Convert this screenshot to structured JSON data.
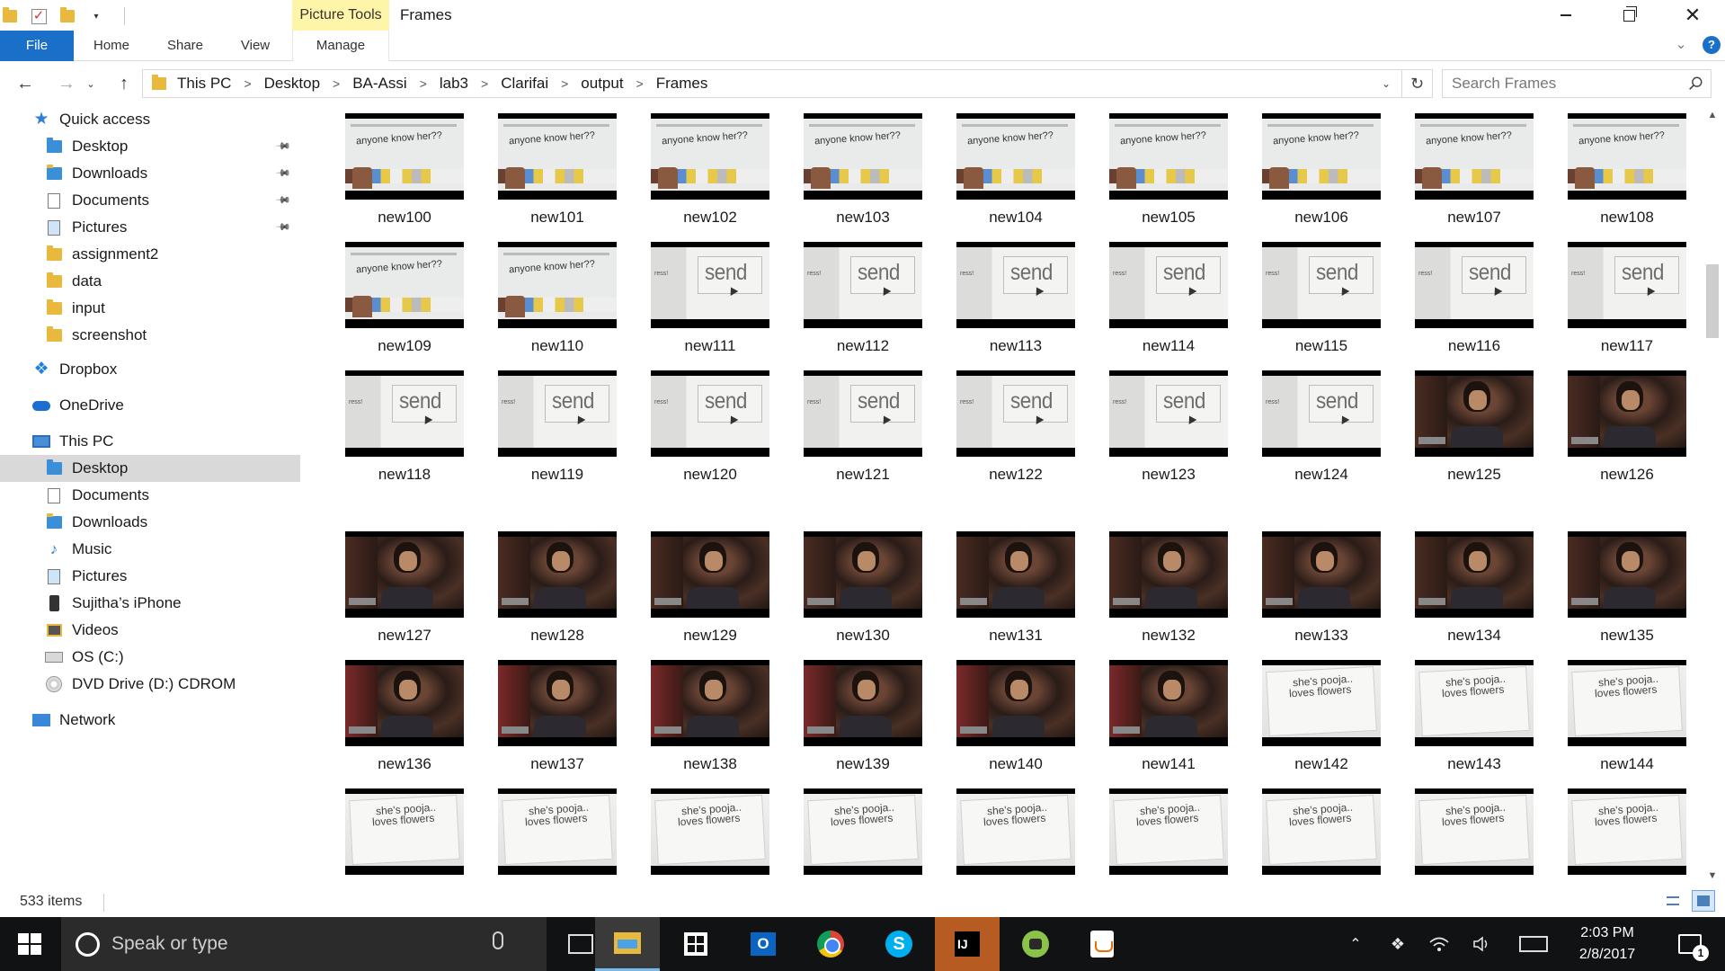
{
  "window": {
    "title": "Frames",
    "context_tab_header": "Picture Tools",
    "minimize_label": "–",
    "close_label": "✕"
  },
  "ribbon": {
    "tabs": [
      "File",
      "Home",
      "Share",
      "View",
      "Manage"
    ],
    "help_label": "?"
  },
  "address": {
    "breadcrumb": [
      "This PC",
      "Desktop",
      "BA-Assi",
      "lab3",
      "Clarifai",
      "output",
      "Frames"
    ],
    "separator": ">",
    "search_placeholder": "Search Frames"
  },
  "nav_pane": {
    "items": [
      {
        "label": "Quick access",
        "icon": "star-icon",
        "level": 0,
        "selected": false,
        "pinned": false
      },
      {
        "label": "Desktop",
        "icon": "folder-blue-icon",
        "level": 1,
        "selected": false,
        "pinned": true
      },
      {
        "label": "Downloads",
        "icon": "downloads-folder-icon",
        "level": 1,
        "selected": false,
        "pinned": true
      },
      {
        "label": "Documents",
        "icon": "documents-folder-icon",
        "level": 1,
        "selected": false,
        "pinned": true
      },
      {
        "label": "Pictures",
        "icon": "pictures-folder-icon",
        "level": 1,
        "selected": false,
        "pinned": true
      },
      {
        "label": "assignment2",
        "icon": "folder-icon",
        "level": 1,
        "selected": false,
        "pinned": false
      },
      {
        "label": "data",
        "icon": "folder-icon",
        "level": 1,
        "selected": false,
        "pinned": false
      },
      {
        "label": "input",
        "icon": "folder-icon",
        "level": 1,
        "selected": false,
        "pinned": false
      },
      {
        "label": "screenshot",
        "icon": "folder-icon",
        "level": 1,
        "selected": false,
        "pinned": false
      },
      {
        "label": "Dropbox",
        "icon": "dropbox-icon",
        "level": 0,
        "selected": false,
        "pinned": false
      },
      {
        "label": "OneDrive",
        "icon": "onedrive-icon",
        "level": 0,
        "selected": false,
        "pinned": false
      },
      {
        "label": "This PC",
        "icon": "computer-icon",
        "level": 0,
        "selected": false,
        "pinned": false
      },
      {
        "label": "Desktop",
        "icon": "folder-blue-icon",
        "level": 1,
        "selected": true,
        "pinned": false
      },
      {
        "label": "Documents",
        "icon": "documents-folder-icon",
        "level": 1,
        "selected": false,
        "pinned": false
      },
      {
        "label": "Downloads",
        "icon": "downloads-folder-icon",
        "level": 1,
        "selected": false,
        "pinned": false
      },
      {
        "label": "Music",
        "icon": "music-folder-icon",
        "level": 1,
        "selected": false,
        "pinned": false
      },
      {
        "label": "Pictures",
        "icon": "pictures-folder-icon",
        "level": 1,
        "selected": false,
        "pinned": false
      },
      {
        "label": "Sujitha’s iPhone",
        "icon": "phone-icon",
        "level": 1,
        "selected": false,
        "pinned": false
      },
      {
        "label": "Videos",
        "icon": "videos-folder-icon",
        "level": 1,
        "selected": false,
        "pinned": false
      },
      {
        "label": "OS (C:)",
        "icon": "drive-icon",
        "level": 1,
        "selected": false,
        "pinned": false
      },
      {
        "label": "DVD Drive (D:) CDROM",
        "icon": "dvd-icon",
        "level": 1,
        "selected": false,
        "pinned": false
      },
      {
        "label": "Network",
        "icon": "network-icon",
        "level": 0,
        "selected": false,
        "pinned": false
      }
    ]
  },
  "files": [
    {
      "name": "new100",
      "scene": "anyone"
    },
    {
      "name": "new101",
      "scene": "anyone"
    },
    {
      "name": "new102",
      "scene": "anyone"
    },
    {
      "name": "new103",
      "scene": "anyone"
    },
    {
      "name": "new104",
      "scene": "anyone"
    },
    {
      "name": "new105",
      "scene": "anyone"
    },
    {
      "name": "new106",
      "scene": "anyone"
    },
    {
      "name": "new107",
      "scene": "anyone"
    },
    {
      "name": "new108",
      "scene": "anyone"
    },
    {
      "name": "new109",
      "scene": "anyone"
    },
    {
      "name": "new110",
      "scene": "anyone"
    },
    {
      "name": "new111",
      "scene": "send"
    },
    {
      "name": "new112",
      "scene": "send"
    },
    {
      "name": "new113",
      "scene": "send"
    },
    {
      "name": "new114",
      "scene": "send"
    },
    {
      "name": "new115",
      "scene": "send"
    },
    {
      "name": "new116",
      "scene": "send"
    },
    {
      "name": "new117",
      "scene": "send"
    },
    {
      "name": "new118",
      "scene": "send"
    },
    {
      "name": "new119",
      "scene": "send"
    },
    {
      "name": "new120",
      "scene": "send"
    },
    {
      "name": "new121",
      "scene": "send"
    },
    {
      "name": "new122",
      "scene": "send"
    },
    {
      "name": "new123",
      "scene": "send"
    },
    {
      "name": "new124",
      "scene": "send"
    },
    {
      "name": "new125",
      "scene": "dark"
    },
    {
      "name": "new126",
      "scene": "dark"
    },
    {
      "name": "new127",
      "scene": "dark"
    },
    {
      "name": "new128",
      "scene": "dark"
    },
    {
      "name": "new129",
      "scene": "dark"
    },
    {
      "name": "new130",
      "scene": "dark"
    },
    {
      "name": "new131",
      "scene": "dark"
    },
    {
      "name": "new132",
      "scene": "dark"
    },
    {
      "name": "new133",
      "scene": "dark"
    },
    {
      "name": "new134",
      "scene": "dark"
    },
    {
      "name": "new135",
      "scene": "dark"
    },
    {
      "name": "new136",
      "scene": "dark-red"
    },
    {
      "name": "new137",
      "scene": "dark-red"
    },
    {
      "name": "new138",
      "scene": "dark-red"
    },
    {
      "name": "new139",
      "scene": "dark-red"
    },
    {
      "name": "new140",
      "scene": "dark-red"
    },
    {
      "name": "new141",
      "scene": "dark-red"
    },
    {
      "name": "new142",
      "scene": "pooja"
    },
    {
      "name": "new143",
      "scene": "pooja"
    },
    {
      "name": "new144",
      "scene": "pooja"
    },
    {
      "name": "",
      "scene": "pooja"
    },
    {
      "name": "",
      "scene": "pooja"
    },
    {
      "name": "",
      "scene": "pooja"
    },
    {
      "name": "",
      "scene": "pooja"
    },
    {
      "name": "",
      "scene": "pooja"
    },
    {
      "name": "",
      "scene": "pooja"
    },
    {
      "name": "",
      "scene": "pooja"
    },
    {
      "name": "",
      "scene": "pooja"
    },
    {
      "name": "",
      "scene": "pooja"
    }
  ],
  "thumb_text": {
    "anyone": "anyone know her??",
    "send": "send",
    "send_side": "ress!",
    "pooja_line1": "she's pooja..",
    "pooja_line2": "loves flowers"
  },
  "status": {
    "item_count": "533 items"
  },
  "taskbar": {
    "search_placeholder": "Speak or type",
    "clock_time": "2:03 PM",
    "clock_date": "2/8/2017",
    "notification_count": "1",
    "outlook_letter": "O",
    "skype_letter": "S",
    "intellij_letters": "IJ"
  },
  "colors": {
    "accent": "#1a70c8",
    "context_tab": "#fff5a8",
    "selected_nav": "#d9d9d9",
    "taskbar": "#111214"
  }
}
